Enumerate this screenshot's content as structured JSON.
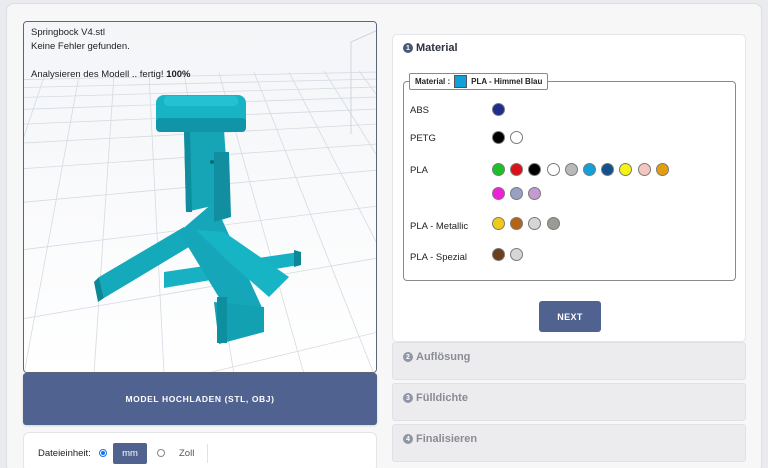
{
  "viewer": {
    "file_name": "Springbock V4.stl",
    "error_status": "Keine Fehler gefunden.",
    "analysis_text": "Analysieren des Modell .. fertig!",
    "analysis_percent": "100%"
  },
  "upload_button": "MODEL HOCHLADEN (STL, OBJ)",
  "units": {
    "label": "Dateieinheit:",
    "options": [
      "mm",
      "Zoll"
    ],
    "selected": "mm"
  },
  "steps": [
    {
      "number": "1",
      "title": "Material"
    },
    {
      "number": "2",
      "title": "Auflösung"
    },
    {
      "number": "3",
      "title": "Fülldichte"
    },
    {
      "number": "4",
      "title": "Finalisieren"
    }
  ],
  "material": {
    "legend_label": "Material :",
    "selected_name": "PLA - Himmel Blau",
    "selected_color": "#12a0d8",
    "groups": [
      {
        "name": "ABS",
        "colors": [
          "#1e2c8c"
        ]
      },
      {
        "name": "PETG",
        "colors": [
          "#000000",
          "#ffffff"
        ]
      },
      {
        "name": "PLA",
        "colors": [
          "#1fbf2a",
          "#d8111b",
          "#000000",
          "#ffffff",
          "#b9b9b9",
          "#12a0d8",
          "#12508e",
          "#f5f214",
          "#f4c6c0",
          "#e29e10",
          "#ef1fd9",
          "#98a1c4",
          "#c49ad0"
        ]
      },
      {
        "name": "PLA - Metallic",
        "colors": [
          "#f2c81b",
          "#b2641a",
          "#d6d6d6",
          "#9b9b94"
        ]
      },
      {
        "name": "PLA - Spezial",
        "colors": [
          "#6e3f1c",
          "#d6d6d6"
        ]
      }
    ]
  },
  "next_button": "NEXT"
}
